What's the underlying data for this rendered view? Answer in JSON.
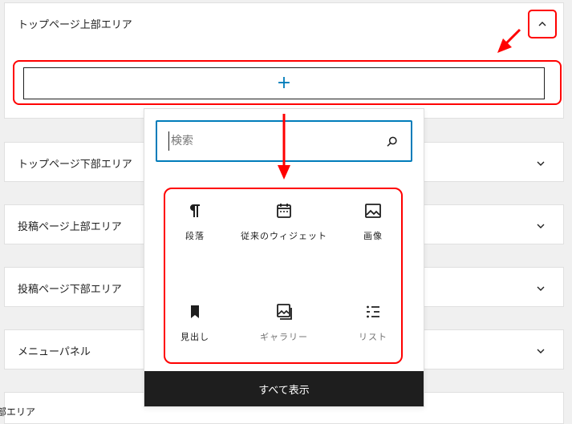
{
  "panels": [
    {
      "title": "トップページ上部エリア",
      "expanded": true
    },
    {
      "title": "トップページ下部エリア"
    },
    {
      "title": "投稿ページ上部エリア"
    },
    {
      "title": "投稿ページ下部エリア"
    },
    {
      "title": "メニューパネル"
    }
  ],
  "appender": {
    "symbol": "+"
  },
  "inserter": {
    "search": {
      "placeholder": "検索"
    },
    "blocks": [
      {
        "label": "段落",
        "icon": "paragraph-icon"
      },
      {
        "label": "従来のウィジェット",
        "icon": "calendar-widget-icon"
      },
      {
        "label": "画像",
        "icon": "image-icon"
      },
      {
        "label": "見出し",
        "icon": "bookmark-heading-icon"
      },
      {
        "label": "ギャラリー",
        "icon": "gallery-icon"
      },
      {
        "label": "リスト",
        "icon": "list-icon"
      }
    ],
    "show_all": "すべて表示"
  },
  "footer": {
    "partial_text": "部エリア"
  },
  "colors": {
    "highlight": "#ff0000",
    "accent": "#007cba",
    "dark": "#1e1e1e"
  }
}
